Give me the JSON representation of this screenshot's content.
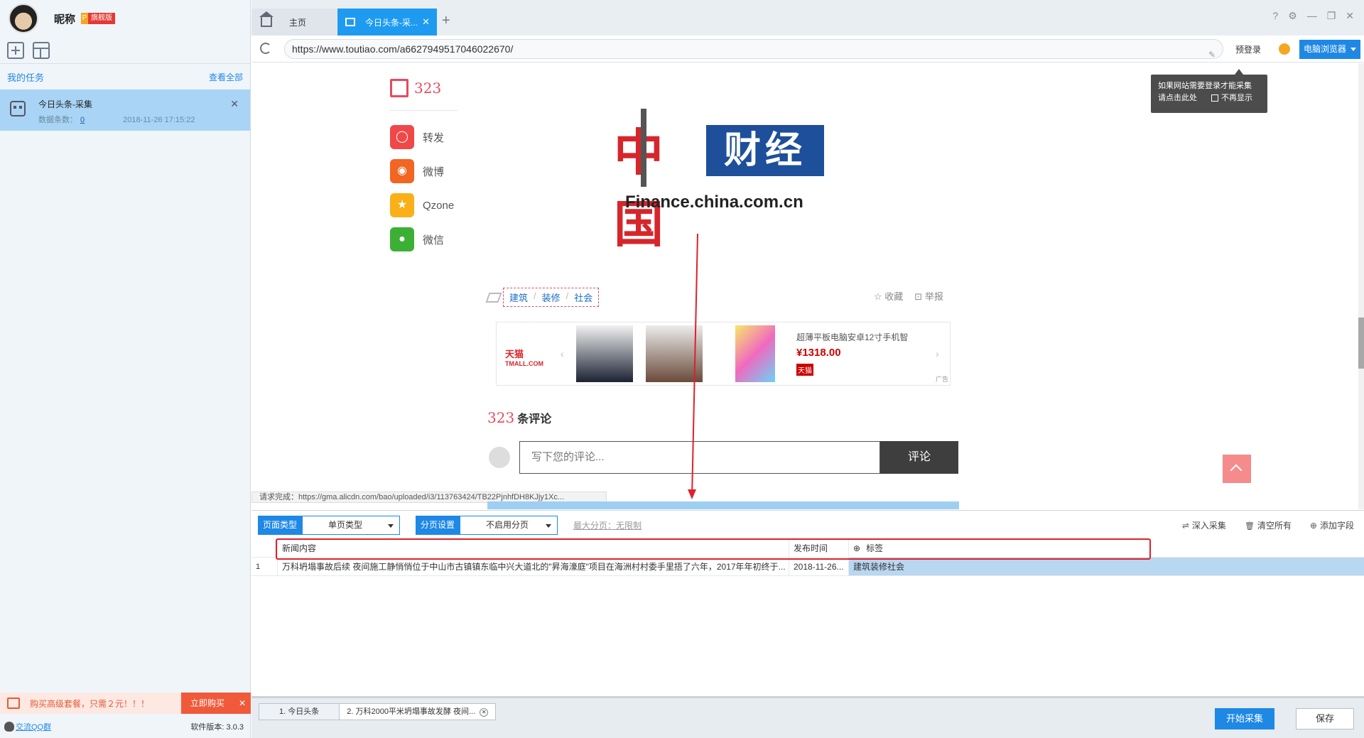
{
  "sidebar": {
    "nickname": "昵称",
    "vip_letter": "P",
    "vip_label": "旗舰版",
    "my_tasks": "我的任务",
    "view_all": "查看全部",
    "task": {
      "name": "今日头条-采集",
      "count_label": "数据条数：",
      "count": "0",
      "time": "2018-11-26 17:15:22"
    },
    "promo": {
      "text": "购买高级套餐，只需２元！！！",
      "buy": "立即购买"
    },
    "qq_group": "交流QQ群",
    "version": "软件版本: 3.0.3"
  },
  "tabs": {
    "home": "主页",
    "active": "今日头条-采..."
  },
  "addressbar": {
    "url": "https://www.toutiao.com/a6627949517046022670/",
    "prelogin": "预登录",
    "browser": "电脑浏览器"
  },
  "tooltip": {
    "line1": "如果网站需要登录才能采集",
    "line2": "请点击此处",
    "no_show": "不再显示"
  },
  "web": {
    "share_count": "323",
    "share_items": [
      {
        "label": "转发",
        "icon": "repost-icon",
        "color": "#f04848",
        "glyph": "◯"
      },
      {
        "label": "微博",
        "icon": "weibo-icon",
        "color": "#f26522",
        "glyph": "◉"
      },
      {
        "label": "Qzone",
        "icon": "qzone-icon",
        "color": "#fbb019",
        "glyph": "★"
      },
      {
        "label": "微信",
        "icon": "wechat-icon",
        "color": "#3cb034",
        "glyph": "●"
      }
    ],
    "logo_seal": "中国",
    "logo_cj": "财经",
    "logo_domain": "Finance.china.com.cn",
    "tags": [
      "建筑",
      "装修",
      "社会"
    ],
    "favorite": "收藏",
    "report": "举报",
    "ad": {
      "tmall": "天猫",
      "tmall_en": "TMALL.COM",
      "product": "超薄平板电脑安卓12寸手机智",
      "price": "¥1318.00",
      "tm_badge": "天猫",
      "ad_label": "广告"
    },
    "comment_count": "323",
    "comment_title": "条评论",
    "comment_placeholder": "写下您的评论...",
    "comment_button": "评论",
    "request_status": "请求完成：https://gma.alicdn.com/bao/uploaded/i3/113763424/TB22PjnhfDH8KJjy1Xc..."
  },
  "panel": {
    "page_type_label": "页面类型",
    "page_type_value": "单页类型",
    "paging_label": "分页设置",
    "paging_value": "不启用分页",
    "max_page": "最大分页：无限制",
    "deep_collect": "深入采集",
    "clear_all": "清空所有",
    "add_field": "添加字段",
    "columns": [
      "新闻内容",
      "发布时间",
      "标签"
    ],
    "rows": [
      {
        "index": "1",
        "content": "万科坍塌事故后续 夜间施工静悄悄位于中山市古镇镇东临中兴大道北的\"昇海濠庭\"项目在海洲村村委手里捂了六年，2017年年初终于...",
        "time": "2018-11-26...",
        "tag": "建筑装修社会"
      }
    ]
  },
  "footer": {
    "tab1": "1. 今日头条",
    "tab2": "2. 万科2000平米坍塌事故发酵 夜间...",
    "start": "开始采集",
    "save": "保存"
  },
  "colors": {
    "accent": "#1e88e5",
    "tab_active": "#1e9bf0",
    "highlight": "#e0202a"
  }
}
